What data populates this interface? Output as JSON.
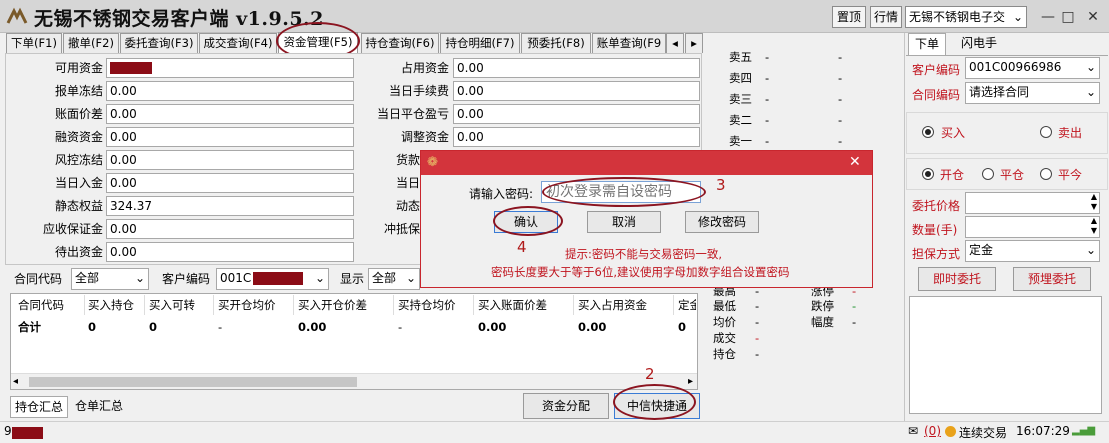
{
  "app": {
    "title": "无锡不锈钢交易客户端 v1.9.5.2",
    "btn_top": "置顶",
    "btn_quote": "行情",
    "exchange": "无锡不锈钢电子交",
    "win_min": "—",
    "win_max": "□",
    "win_close": "✕"
  },
  "tabs": [
    "下单(F1)",
    "撤单(F2)",
    "委托查询(F3)",
    "成交查询(F4)",
    "资金管理(F5)",
    "持仓查询(F6)",
    "持仓明细(F7)",
    "预委托(F8)",
    "账单查询(F9"
  ],
  "tab_scroll": {
    "left": "◂",
    "right": "▸"
  },
  "left_fields": [
    {
      "label": "可用资金",
      "value": ""
    },
    {
      "label": "报单冻结",
      "value": "0.00"
    },
    {
      "label": "账面价差",
      "value": "0.00"
    },
    {
      "label": "融资资金",
      "value": "0.00"
    },
    {
      "label": "风控冻结",
      "value": "0.00"
    },
    {
      "label": "当日入金",
      "value": "0.00"
    },
    {
      "label": "静态权益",
      "value": "324.37"
    },
    {
      "label": "应收保证金",
      "value": "0.00"
    },
    {
      "label": "待出资金",
      "value": "0.00"
    }
  ],
  "mid_fields": [
    {
      "label": "占用资金",
      "value": "0.00"
    },
    {
      "label": "当日手续费",
      "value": "0.00"
    },
    {
      "label": "当日平仓盈亏",
      "value": "0.00"
    },
    {
      "label": "调整资金",
      "value": "0.00"
    },
    {
      "label": "货款",
      "value": ""
    },
    {
      "label": "当日",
      "value": ""
    },
    {
      "label": "动态",
      "value": ""
    },
    {
      "label": "冲抵保",
      "value": ""
    }
  ],
  "annotations": {
    "n1": "1",
    "n2": "2",
    "n3": "3",
    "n4": "4"
  },
  "filter": {
    "contract_label": "合同代码",
    "contract_value": "全部",
    "customer_label": "客户编码",
    "customer_value": "001C",
    "show_label": "显示",
    "show_value": "全部"
  },
  "grid": {
    "headers": [
      "合同代码",
      "买入持仓",
      "买入可转",
      "买开仓均价",
      "买入开仓价差",
      "买持仓均价",
      "买入账面价差",
      "买入占用资金",
      "定金"
    ],
    "total_row": [
      "合计",
      "0",
      "0",
      "-",
      "0.00",
      "-",
      "0.00",
      "0.00",
      "0"
    ]
  },
  "bottom_tabs": [
    "持仓汇总",
    "仓单汇总"
  ],
  "bottom_btns": {
    "alloc": "资金分配",
    "quick": "中信快捷通"
  },
  "quote_sell": [
    {
      "label": "卖五",
      "a": "-",
      "b": "-"
    },
    {
      "label": "卖四",
      "a": "-",
      "b": "-"
    },
    {
      "label": "卖三",
      "a": "-",
      "b": "-"
    },
    {
      "label": "卖二",
      "a": "-",
      "b": "-"
    },
    {
      "label": "卖一",
      "a": "-",
      "b": "-"
    }
  ],
  "quote_stats_left": [
    {
      "label": "最高",
      "v": "-"
    },
    {
      "label": "最低",
      "v": "-"
    },
    {
      "label": "均价",
      "v": "-"
    },
    {
      "label": "成交",
      "v": "-"
    },
    {
      "label": "持仓",
      "v": "-"
    }
  ],
  "quote_stats_right": [
    {
      "label": "涨停",
      "v": "-"
    },
    {
      "label": "跌停",
      "v": "-"
    },
    {
      "label": "幅度",
      "v": "-"
    }
  ],
  "order": {
    "tab_order": "下单",
    "tab_flash": "闪电手",
    "customer_label": "客户编码",
    "customer_value": "001C00966986",
    "contract_label": "合同编码",
    "contract_value": "请选择合同",
    "buy": "买入",
    "sell": "卖出",
    "open": "开仓",
    "close": "平仓",
    "close_today": "平今",
    "price_label": "委托价格",
    "qty_label": "数量(手)",
    "guarantee_label": "担保方式",
    "guarantee_value": "定金",
    "btn_now": "即时委托",
    "btn_pre": "预埋委托"
  },
  "dialog": {
    "icon": "❁",
    "close": "✕",
    "pwd_label": "请输入密码:",
    "pwd_placeholder": "初次登录需自设密码",
    "ok": "确认",
    "cancel": "取消",
    "change": "修改密码",
    "hint1": "提示:密码不能与交易密码一致,",
    "hint2": "密码长度要大于等于6位,建议使用字母加数字组合设置密码"
  },
  "statusbar": {
    "left": "9",
    "mail_count": "(0)",
    "connect": "连续交易",
    "time": "16:07:29"
  }
}
